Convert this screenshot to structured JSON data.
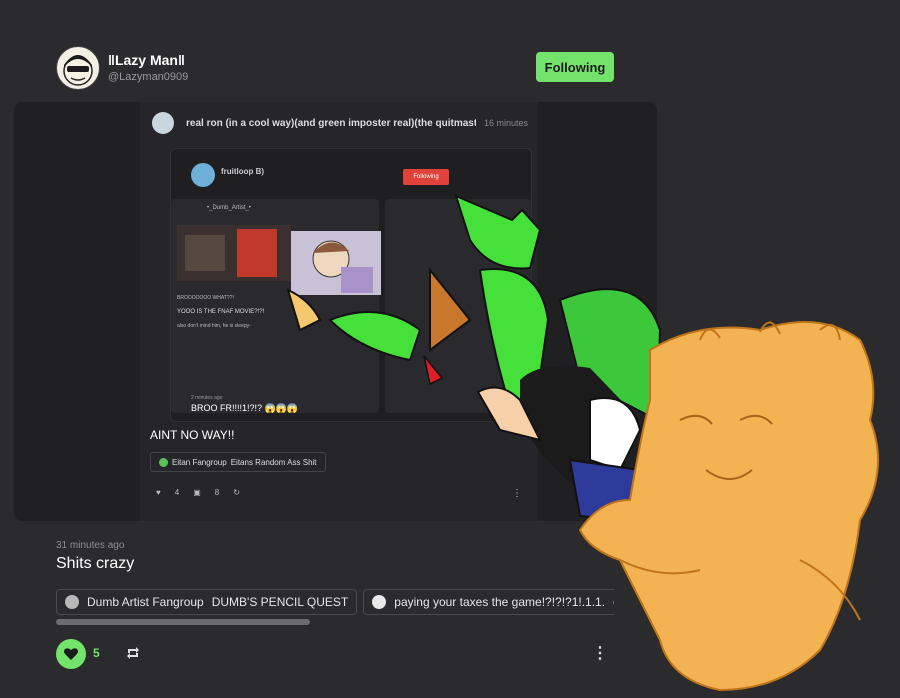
{
  "post": {
    "author_name": "‖Lazy Man‖",
    "author_handle": "@Lazyman0909",
    "follow_label": "Following",
    "timestamp": "31 minutes ago",
    "caption": "Shits crazy",
    "tags": [
      {
        "name": "Dumb Artist Fangroup",
        "sub": "DUMB'S PENCIL QUEST"
      },
      {
        "name": "paying your taxes the game!?!?!?1!.1.1.",
        "sub": "genera"
      }
    ],
    "like_count": "5",
    "icons": [
      "heart-icon",
      "reblog-icon",
      "more-icon"
    ],
    "accent_color": "#74e36b"
  },
  "inner_post": {
    "title": "real ron (in a cool way)(and green imposter real)(the quitmaster)...",
    "time": "16 minutes",
    "caption": "AINT NO WAY!!",
    "tags": [
      {
        "name": "Eitan Fangroup",
        "sub": "Eitans Random Ass Shit"
      }
    ],
    "like_count": "4",
    "comment_count": "8"
  },
  "nested_post": {
    "author_name": "fruitloop B)",
    "follow_label": "Following",
    "card_title": "•_Dumb_Artist_•",
    "text1": "BROOOOOOO WHAT??!",
    "text2": "YOOO IS THE FNAF MOVIE?!?!",
    "text3": "also don't mind him, he is sleepy-",
    "time": "2 minutes ago",
    "reply": "BROO FR!!!!1!?!? 😱😱😱"
  }
}
